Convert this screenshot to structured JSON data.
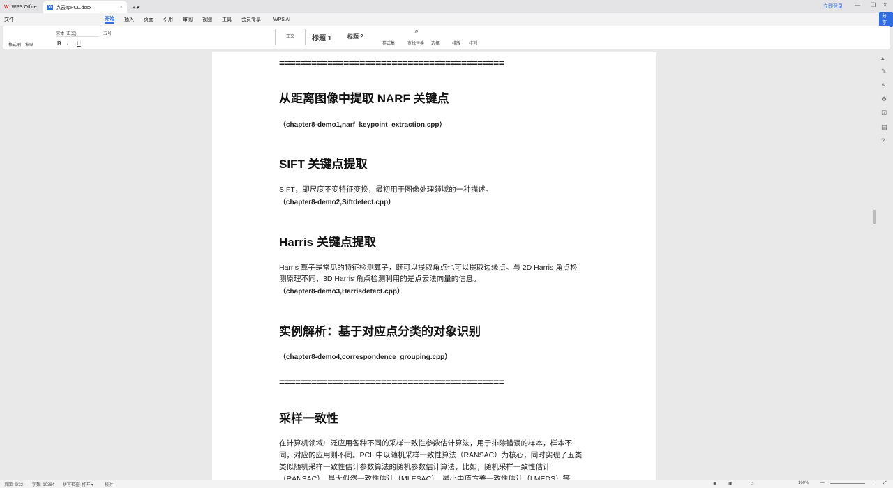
{
  "tabs": [
    {
      "label": "WPS Office"
    },
    {
      "label": "点云库PCL.docx"
    }
  ],
  "window": {
    "login": "立即登录",
    "share": "分享"
  },
  "menu": {
    "file": "文件",
    "items": [
      "开始",
      "插入",
      "页面",
      "引用",
      "审阅",
      "视图",
      "工具",
      "会员专享"
    ],
    "ai": "WPS AI"
  },
  "ribbon": {
    "format_painter": "格式刷",
    "paste": "粘贴",
    "font": "宋体 (正文)",
    "size": "五号",
    "style_normal": "正文",
    "style_h1": "标题 1",
    "style_h2": "标题 2",
    "styles": "样式集",
    "find_replace": "查找替换",
    "select": "选择",
    "layout": "排版",
    "arrange": "排列"
  },
  "doc": {
    "sep": "==========================================",
    "h1": "从距离图像中提取 NARF 关键点",
    "c1": "（chapter8-demo1,narf_keypoint_extraction.cpp）",
    "h2": "SIFT 关键点提取",
    "p2": "SIFT，即尺度不变特征变换，最初用于图像处理领域的一种描述。",
    "c2": "（chapter8-demo2,Siftdetect.cpp）",
    "h3": "Harris 关键点提取",
    "p3a": "Harris 算子是常见的特征检测算子，既可以提取角点也可以提取边缘点。与 2D Harris 角点检",
    "p3b": "测原理不同，3D Harris 角点检测利用的是点云法向量的信息。",
    "c3": "（chapter8-demo3,Harrisdetect.cpp）",
    "h4": "实例解析：基于对应点分类的对象识别",
    "c4": "（chapter8-demo4,correspondence_grouping.cpp）",
    "h5": "采样一致性",
    "p5a": "在计算机领域广泛应用各种不同的采样一致性参数估计算法，用于排除错误的样本，样本不",
    "p5b": "同，对应的应用则不同。PCL 中以随机采样一致性算法（RANSAC）为核心，同时实现了五类",
    "p5c": "类似随机采样一致性估计参数算法的随机参数估计算法，比如，随机采样一致性估计",
    "p5d": "（RANSAC）、最大似然一致性估计（MLESAC）、最小中值方差一致性估计（LMEDS）等。"
  },
  "status": {
    "page": "页面: 9/22",
    "words": "字数: 10384",
    "spell": "拼写检查: 打开 ▾",
    "proof": "校对",
    "zoom": "160%"
  }
}
